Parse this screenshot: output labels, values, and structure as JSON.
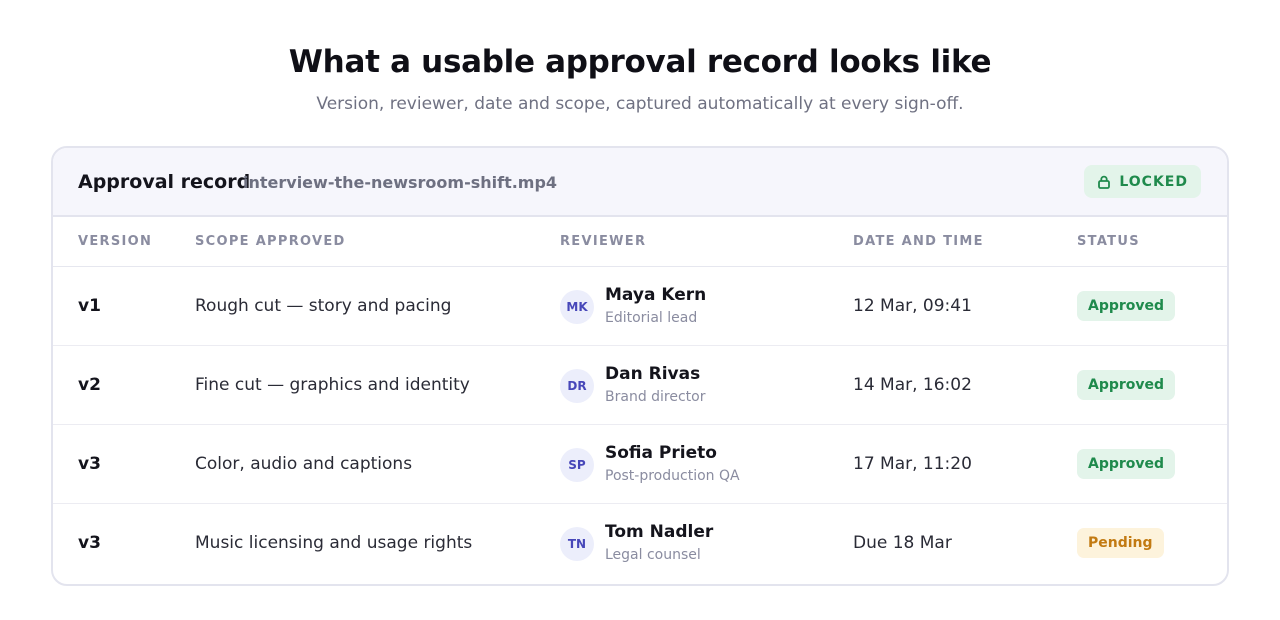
{
  "page": {
    "headline": "What a usable approval record looks like",
    "subhead": "Version, reviewer, date and scope, captured automatically at every sign-off."
  },
  "record": {
    "title": "Approval record",
    "filename": "interview-the-newsroom-shift.mp4",
    "locked_label": "LOCKED",
    "locked_icon": "lock-icon"
  },
  "table": {
    "columns": [
      "VERSION",
      "SCOPE APPROVED",
      "REVIEWER",
      "DATE AND TIME",
      "STATUS"
    ],
    "rows": [
      {
        "version": "v1",
        "scope": "Rough cut — story and pacing",
        "initials": "MK",
        "reviewer": "Maya Kern",
        "role": "Editorial lead",
        "date": "12 Mar, 09:41",
        "status": "Approved"
      },
      {
        "version": "v2",
        "scope": "Fine cut — graphics and identity",
        "initials": "DR",
        "reviewer": "Dan Rivas",
        "role": "Brand director",
        "date": "14 Mar, 16:02",
        "status": "Approved"
      },
      {
        "version": "v3",
        "scope": "Color, audio and captions",
        "initials": "SP",
        "reviewer": "Sofia Prieto",
        "role": "Post-production QA",
        "date": "17 Mar, 11:20",
        "status": "Approved"
      },
      {
        "version": "v3",
        "scope": "Music licensing and usage rights",
        "initials": "TN",
        "reviewer": "Tom Nadler",
        "role": "Legal counsel",
        "date": "Due 18 Mar",
        "status": "Pending"
      }
    ]
  },
  "colors": {
    "approved_bg": "#e3f4ea",
    "approved_text": "#1f8a4c",
    "pending_bg": "#fdf3dc",
    "pending_text": "#c27a12",
    "avatar_bg": "#eceefb",
    "avatar_text": "#4747b9"
  }
}
